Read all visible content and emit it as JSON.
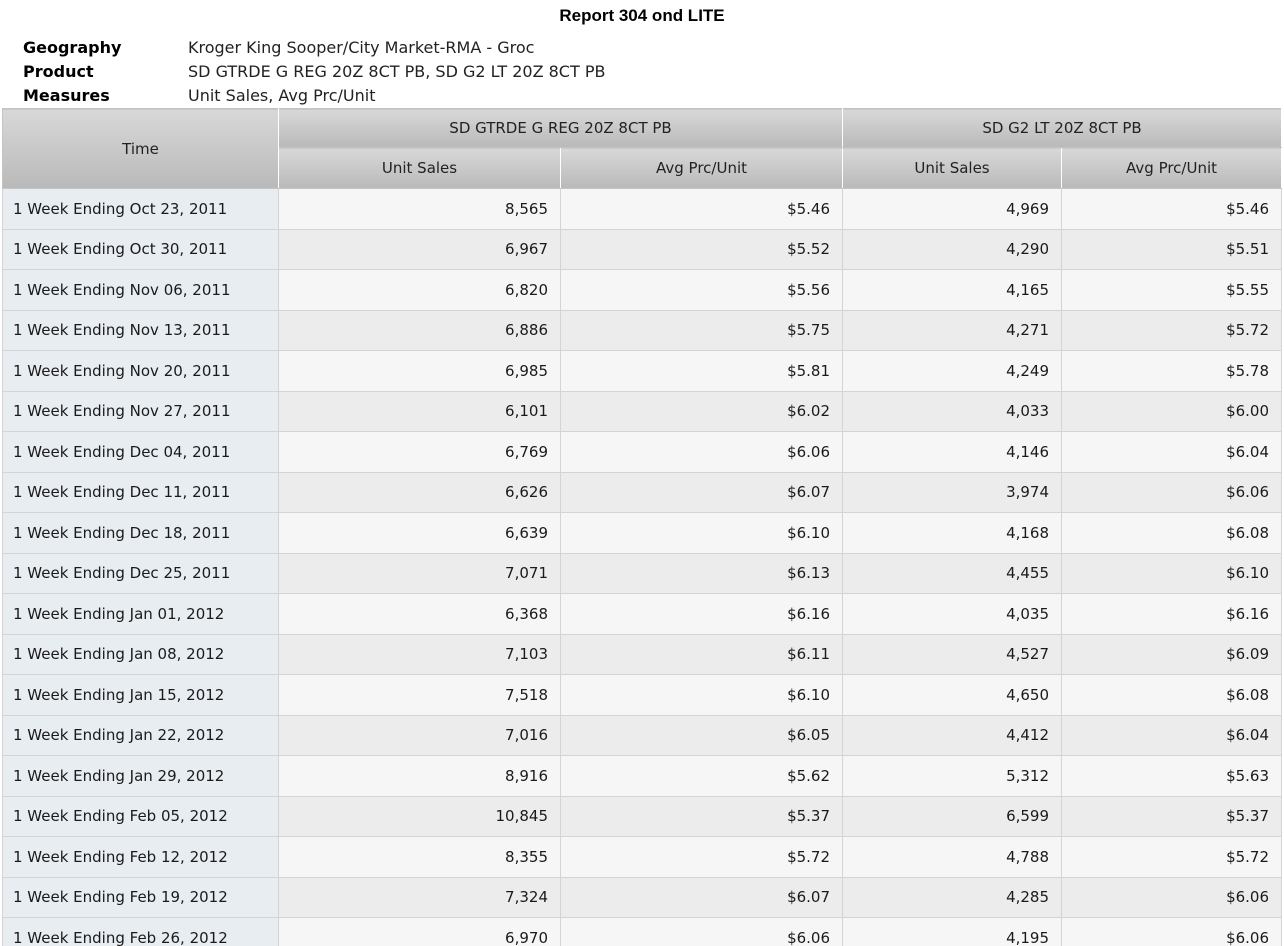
{
  "report": {
    "title": "Report 304 ond LITE"
  },
  "meta": [
    {
      "label": "Geography",
      "value": "Kroger King Sooper/City Market-RMA - Groc"
    },
    {
      "label": "Product",
      "value": "SD GTRDE G REG 20Z 8CT PB, SD G2 LT 20Z 8CT PB"
    },
    {
      "label": "Measures",
      "value": "Unit Sales, Avg Prc/Unit"
    }
  ],
  "table": {
    "time_header": "Time",
    "products": [
      "SD GTRDE G REG 20Z 8CT PB",
      "SD G2 LT 20Z 8CT PB"
    ],
    "measures": [
      "Unit Sales",
      "Avg Prc/Unit",
      "Unit Sales",
      "Avg Prc/Unit"
    ],
    "rows": [
      {
        "time": "1 Week Ending Oct 23, 2011",
        "values": [
          "8,565",
          "$5.46",
          "4,969",
          "$5.46"
        ]
      },
      {
        "time": "1 Week Ending Oct 30, 2011",
        "values": [
          "6,967",
          "$5.52",
          "4,290",
          "$5.51"
        ]
      },
      {
        "time": "1 Week Ending Nov 06, 2011",
        "values": [
          "6,820",
          "$5.56",
          "4,165",
          "$5.55"
        ]
      },
      {
        "time": "1 Week Ending Nov 13, 2011",
        "values": [
          "6,886",
          "$5.75",
          "4,271",
          "$5.72"
        ]
      },
      {
        "time": "1 Week Ending Nov 20, 2011",
        "values": [
          "6,985",
          "$5.81",
          "4,249",
          "$5.78"
        ]
      },
      {
        "time": "1 Week Ending Nov 27, 2011",
        "values": [
          "6,101",
          "$6.02",
          "4,033",
          "$6.00"
        ]
      },
      {
        "time": "1 Week Ending Dec 04, 2011",
        "values": [
          "6,769",
          "$6.06",
          "4,146",
          "$6.04"
        ]
      },
      {
        "time": "1 Week Ending Dec 11, 2011",
        "values": [
          "6,626",
          "$6.07",
          "3,974",
          "$6.06"
        ]
      },
      {
        "time": "1 Week Ending Dec 18, 2011",
        "values": [
          "6,639",
          "$6.10",
          "4,168",
          "$6.08"
        ]
      },
      {
        "time": "1 Week Ending Dec 25, 2011",
        "values": [
          "7,071",
          "$6.13",
          "4,455",
          "$6.10"
        ]
      },
      {
        "time": "1 Week Ending Jan 01, 2012",
        "values": [
          "6,368",
          "$6.16",
          "4,035",
          "$6.16"
        ]
      },
      {
        "time": "1 Week Ending Jan 08, 2012",
        "values": [
          "7,103",
          "$6.11",
          "4,527",
          "$6.09"
        ]
      },
      {
        "time": "1 Week Ending Jan 15, 2012",
        "values": [
          "7,518",
          "$6.10",
          "4,650",
          "$6.08"
        ]
      },
      {
        "time": "1 Week Ending Jan 22, 2012",
        "values": [
          "7,016",
          "$6.05",
          "4,412",
          "$6.04"
        ]
      },
      {
        "time": "1 Week Ending Jan 29, 2012",
        "values": [
          "8,916",
          "$5.62",
          "5,312",
          "$5.63"
        ]
      },
      {
        "time": "1 Week Ending Feb 05, 2012",
        "values": [
          "10,845",
          "$5.37",
          "6,599",
          "$5.37"
        ]
      },
      {
        "time": "1 Week Ending Feb 12, 2012",
        "values": [
          "8,355",
          "$5.72",
          "4,788",
          "$5.72"
        ]
      },
      {
        "time": "1 Week Ending Feb 19, 2012",
        "values": [
          "7,324",
          "$6.07",
          "4,285",
          "$6.06"
        ]
      },
      {
        "time": "1 Week Ending Feb 26, 2012",
        "values": [
          "6,970",
          "$6.06",
          "4,195",
          "$6.06"
        ]
      }
    ]
  }
}
